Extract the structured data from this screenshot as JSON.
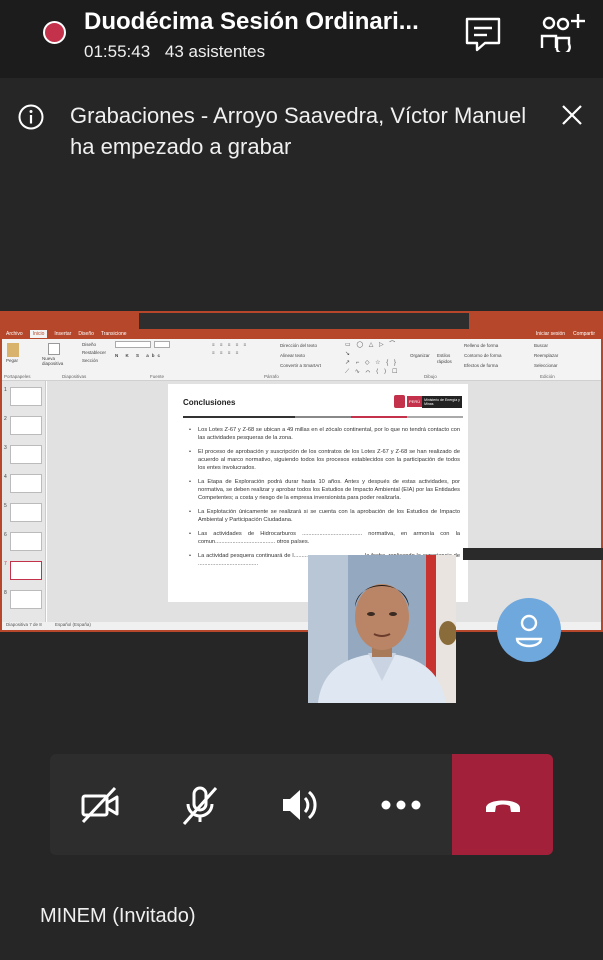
{
  "header": {
    "title": "Duodécima Sesión Ordinari...",
    "duration": "01:55:43",
    "attendees": "43 asistentes"
  },
  "banner": {
    "text": "Grabaciones - Arroyo Saavedra, Víctor Manuel ha empezado a grabar"
  },
  "powerpoint": {
    "tabs": [
      "Archivo",
      "Inicio",
      "Insertar",
      "Diseño",
      "Transicione"
    ],
    "active_tab": "Inicio",
    "sign_in": "Iniciar sesión",
    "share": "Compartir",
    "ribbon": {
      "paste": "Pegar",
      "new_slide": "Nueva diapositiva",
      "layout": "Diseño",
      "reset": "Restablecer",
      "section": "Sección",
      "text_direction": "Dirección del texto",
      "align_text": "Alinear texto",
      "convert_smartart": "Convertir a SmartArt",
      "arrange": "Organizar",
      "quick_styles": "Estilos rápidos",
      "shape_fill": "Relleno de forma",
      "shape_outline": "Contorno de forma",
      "shape_effects": "Efectos de forma",
      "find": "Buscar",
      "replace": "Reemplazar",
      "select": "Seleccionar",
      "groups": [
        "Portapapeles",
        "Diapositivas",
        "Fuente",
        "Párrafo",
        "Dibujo",
        "Edición"
      ]
    },
    "thumbnail_numbers": [
      "1",
      "2",
      "3",
      "4",
      "5",
      "6",
      "7",
      "8"
    ],
    "slide": {
      "title": "Conclusiones",
      "logo_peru": "PERÚ",
      "logo_ministry": "Ministerio de Energía y Minas",
      "bullets": [
        "Los Lotes Z-67 y Z-68 se ubican a 49 millas en el zócalo continental, por lo que no tendrá contacto con las actividades pesqueras de la zona.",
        "El proceso de aprobación y suscripción de los contratos de los Lotes Z-67 y Z-68 se han realizado de acuerdo al marco normativo, siguiendo todos los procesos establecidos con la participación de todos los entes involucrados.",
        "La Etapa de Exploración podrá durar hasta 10 años. Antes y después de estas actividades, por normativa, se deben realizar y aprobar todos los Estudios de Impacto Ambiental (EIA) por las Entidades Competentes; a costa y riesgo de la empresa inversionista para poder realizarla.",
        "La Explotación únicamente se realizará si se cuenta con la aprobación de los Estudios de Impacto Ambiental y Participación Ciudadana.",
        "Las actividades de Hidrocarburos ...................................... normativa, en armonía con la comun...................................... otros países.",
        "La actividad pesquera continuará de l............................................ la fecha, replicando la experiencia de ......................................"
      ]
    },
    "status_slide": "Diapositiva 7 de 8",
    "status_lang": "Español (España)"
  },
  "controls": {
    "camera": "camera-off",
    "mic": "mic-off",
    "speaker": "speaker",
    "more": "more",
    "hangup": "hang-up"
  },
  "self_name": "MINEM (Invitado)",
  "colors": {
    "header_bg": "#1c1c1c",
    "app_bg": "#262626",
    "hangup": "#a3203a",
    "recording": "#c4314b",
    "avatar": "#6fa8dc",
    "ppt_accent": "#b7472a"
  }
}
